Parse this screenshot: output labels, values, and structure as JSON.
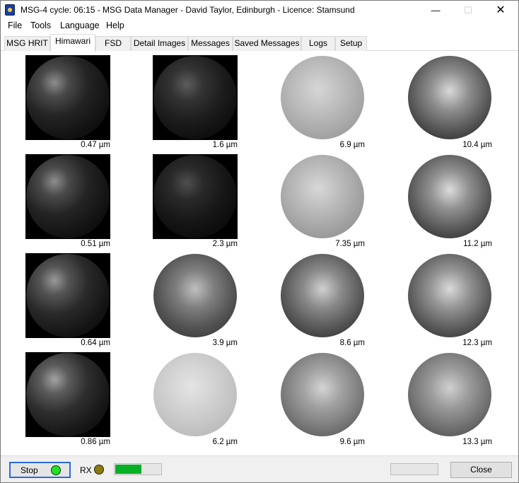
{
  "window": {
    "title": "MSG-4 cycle: 06:15 - MSG Data Manager - David Taylor, Edinburgh - Licence: Stamsund",
    "minimize_glyph": "—",
    "maximize_glyph": "☐",
    "close_glyph": "✕"
  },
  "menu": [
    "File",
    "Tools",
    "Language",
    "Help"
  ],
  "tabs": [
    {
      "label": "MSG HRIT",
      "active": false
    },
    {
      "label": "Himawari",
      "active": true
    },
    {
      "label": "FSD",
      "active": false
    },
    {
      "label": "Detail Images",
      "active": false
    },
    {
      "label": "Messages",
      "active": false
    },
    {
      "label": "Saved Messages",
      "active": false
    },
    {
      "label": "Logs",
      "active": false
    },
    {
      "label": "Setup",
      "active": false
    }
  ],
  "channels": [
    [
      "0.47 µm",
      "1.6 µm",
      "6.9 µm",
      "10.4 µm"
    ],
    [
      "0.51 µm",
      "2.3 µm",
      "7.35 µm",
      "11.2 µm"
    ],
    [
      "0.64 µm",
      "3.9 µm",
      "8.6 µm",
      "12.3 µm"
    ],
    [
      "0.86 µm",
      "6.2 µm",
      "9.6 µm",
      "13.3 µm"
    ]
  ],
  "status": {
    "stop_label": "Stop",
    "rx_label": "RX",
    "signal_level": 0.58,
    "close_label": "Close"
  }
}
